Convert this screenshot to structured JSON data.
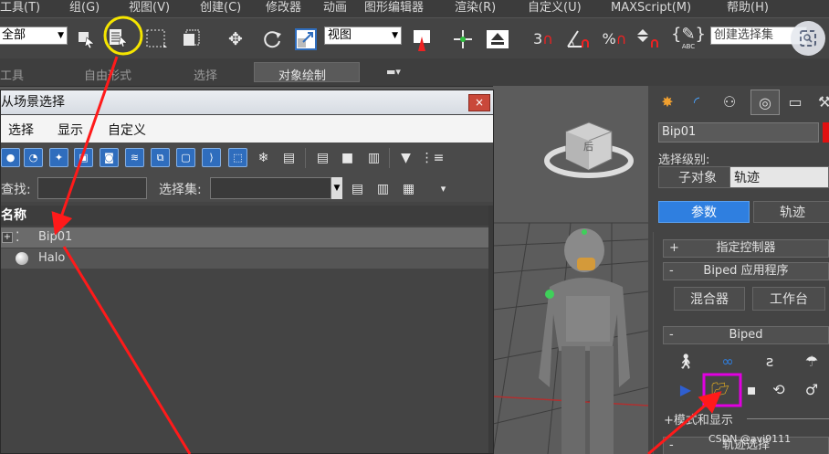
{
  "menu": [
    "工具(T)",
    "组(G)",
    "视图(V)",
    "创建(C)",
    "修改器",
    "动画",
    "图形编辑器",
    "渲染(R)",
    "自定义(U)",
    "MAXScript(M)",
    "帮助(H)"
  ],
  "toolbar": {
    "filter_select": "全部",
    "view_select": "视图",
    "named_selection": "创建选择集",
    "snap3": "3",
    "percent": "%",
    "abc": "ABC"
  },
  "ribbon": [
    "工具",
    "自由形式",
    "选择",
    "对象绘制"
  ],
  "dialog": {
    "title": "从场景选择",
    "close": "×",
    "menu": [
      "选择",
      "显示",
      "自定义"
    ],
    "find_label": "查找:",
    "selset_label": "选择集:",
    "column_name": "名称",
    "rows": [
      {
        "expand": "+",
        "name": "Bip01"
      },
      {
        "expand": "",
        "name": "Halo"
      }
    ]
  },
  "cube_label": "后",
  "panel": {
    "object_name": "Bip01",
    "sel_level_label": "选择级别:",
    "sub_object": "子对象",
    "track": "轨迹",
    "btn_params": "参数",
    "btn_track": "轨迹",
    "rollout_assign": "指定控制器",
    "rollout_biped_app": "Biped 应用程序",
    "btn_mixer": "混合器",
    "btn_workbench": "工作台",
    "rollout_biped": "Biped",
    "mode_display": "+模式和显示",
    "track_select": "轨迹选择"
  },
  "watermark": "CSDN @avi9111",
  "colors": {
    "accent_blue": "#2f7fe0",
    "arrow_red": "#ff1a1a",
    "highlight_yellow": "#f5e500",
    "highlight_magenta": "#e000e0"
  }
}
